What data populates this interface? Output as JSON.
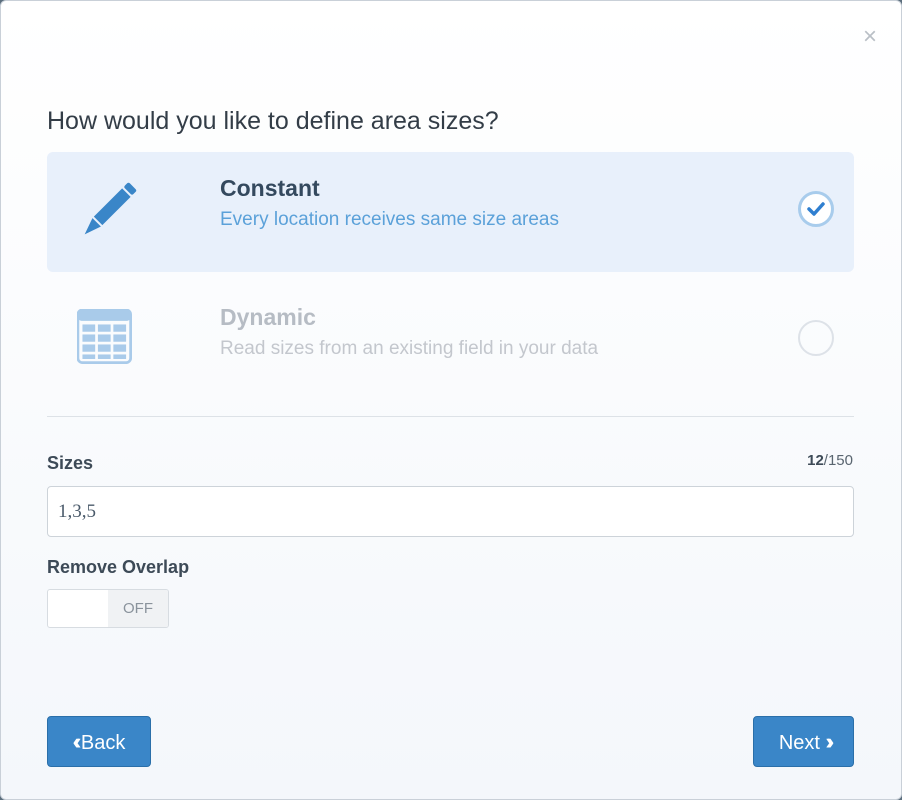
{
  "dialog": {
    "close_symbol": "×",
    "question": "How would you like to define area sizes?"
  },
  "options": [
    {
      "title": "Constant",
      "description": "Every location receives same size areas",
      "icon": "pencil-icon",
      "selected": true
    },
    {
      "title": "Dynamic",
      "description": "Read sizes from an existing field in your data",
      "icon": "table-icon",
      "selected": false
    }
  ],
  "sizes": {
    "label": "Sizes",
    "value": "1,3,5",
    "count_current": "12",
    "count_max": "/150"
  },
  "overlap": {
    "label": "Remove Overlap",
    "toggle_state": "OFF"
  },
  "buttons": {
    "back_label": "Back",
    "next_label": "Next"
  },
  "colors": {
    "accent": "#3a86c8",
    "selected_bg": "#e8f0fb",
    "icon_blue": "#3a86c8",
    "icon_light": "#a9cbea"
  }
}
